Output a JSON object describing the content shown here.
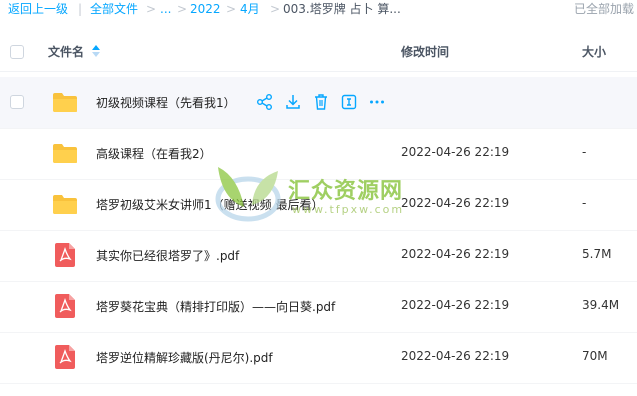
{
  "breadcrumb": {
    "back": "返回上一级",
    "sep": "|",
    "all_files": "全部文件",
    "arrow": ">",
    "ellipsis": "...",
    "year": "2022",
    "month": "4月",
    "current": "003.塔罗牌 占卜 算...",
    "status": "已全部加载"
  },
  "columns": {
    "name": "文件名",
    "modified": "修改时间",
    "size": "大小"
  },
  "files": [
    {
      "name": "初级视频课程（先看我1）",
      "date": "",
      "size": "",
      "type": "folder"
    },
    {
      "name": "高级课程（在看我2）",
      "date": "2022-04-26 22:19",
      "size": "-",
      "type": "folder"
    },
    {
      "name": "塔罗初级艾米女讲师1（赠送视频 最后看）",
      "date": "2022-04-26 22:19",
      "size": "-",
      "type": "folder"
    },
    {
      "name": "其实你已经很塔罗了》.pdf",
      "date": "2022-04-26 22:19",
      "size": "5.7M",
      "type": "pdf"
    },
    {
      "name": "塔罗葵花宝典（精排打印版）——向日葵.pdf",
      "date": "2022-04-26 22:19",
      "size": "39.4M",
      "type": "pdf"
    },
    {
      "name": "塔罗逆位精解珍藏版(丹尼尔).pdf",
      "date": "2022-04-26 22:19",
      "size": "70M",
      "type": "pdf"
    }
  ],
  "watermark": {
    "title": "汇众资源网",
    "url": "www.tfpxw.com"
  },
  "colors": {
    "accent": "#06a7ff",
    "folder": "#f9c23c",
    "pdf": "#f05c5c",
    "watermark": "#7fbf2e"
  }
}
